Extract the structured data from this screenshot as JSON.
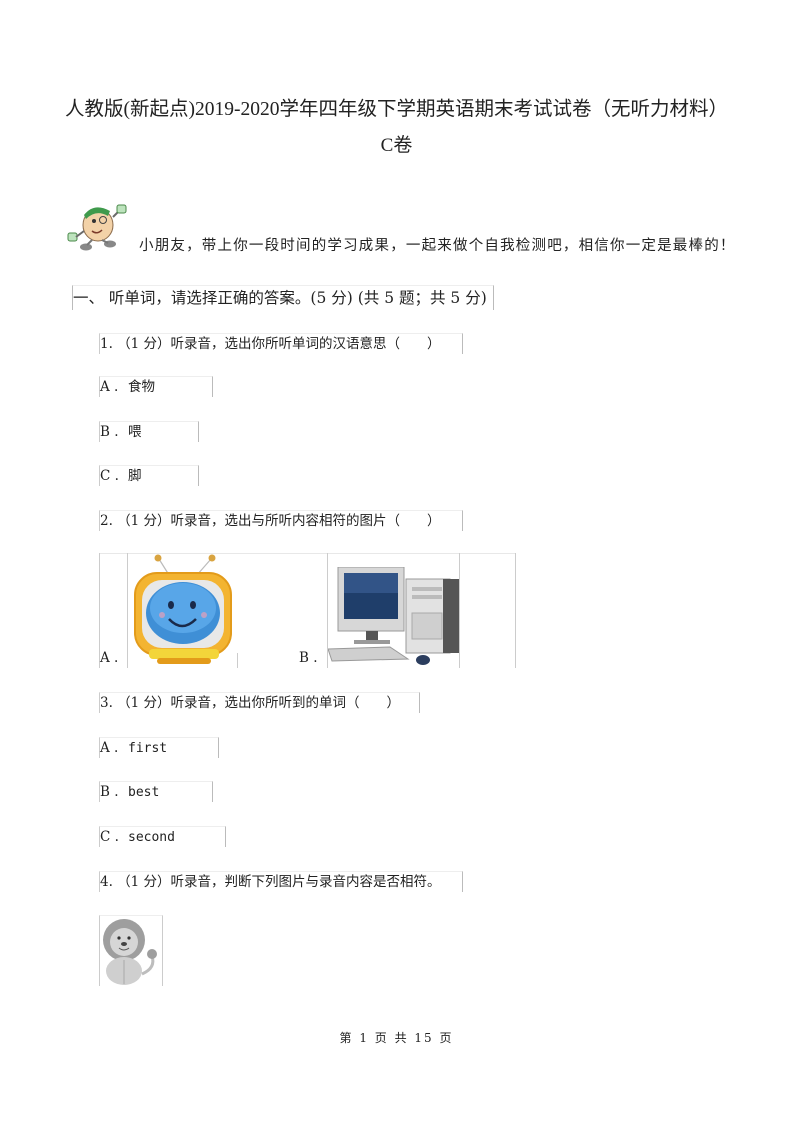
{
  "document": {
    "title": "人教版(新起点)2019-2020学年四年级下学期英语期末考试试卷（无听力材料）",
    "subtitle": "C卷",
    "intro": "小朋友，带上你一段时间的学习成果，一起来做个自我检测吧，相信你一定是最棒的！",
    "mascot_icon": "cartoon-mascot-icon"
  },
  "section1": {
    "heading": "一、 听单词，请选择正确的答案。(5 分) (共 5 题；共 5 分)"
  },
  "questions": [
    {
      "stem": "1. （1 分）听录音，选出你所听单词的汉语意思（　　）",
      "options": [
        {
          "label": "A .",
          "text": "食物"
        },
        {
          "label": "B .",
          "text": "喂"
        },
        {
          "label": "C .",
          "text": "脚"
        }
      ]
    },
    {
      "stem": "2. （1 分）听录音，选出与所听内容相符的图片（　　）",
      "image_options": [
        {
          "label": "A .",
          "image": "cartoon-tv-icon"
        },
        {
          "label": "B .",
          "image": "desktop-computer-icon"
        }
      ]
    },
    {
      "stem": "3. （1 分）听录音，选出你所听到的单词（　　）",
      "options": [
        {
          "label": "A .",
          "text": "first"
        },
        {
          "label": "B .",
          "text": "best"
        },
        {
          "label": "C .",
          "text": "second"
        }
      ]
    },
    {
      "stem": "4. （1 分）听录音，判断下列图片与录音内容是否相符。",
      "image": "lion-icon"
    }
  ],
  "footer": {
    "page_text": "第 1 页 共 15 页"
  }
}
